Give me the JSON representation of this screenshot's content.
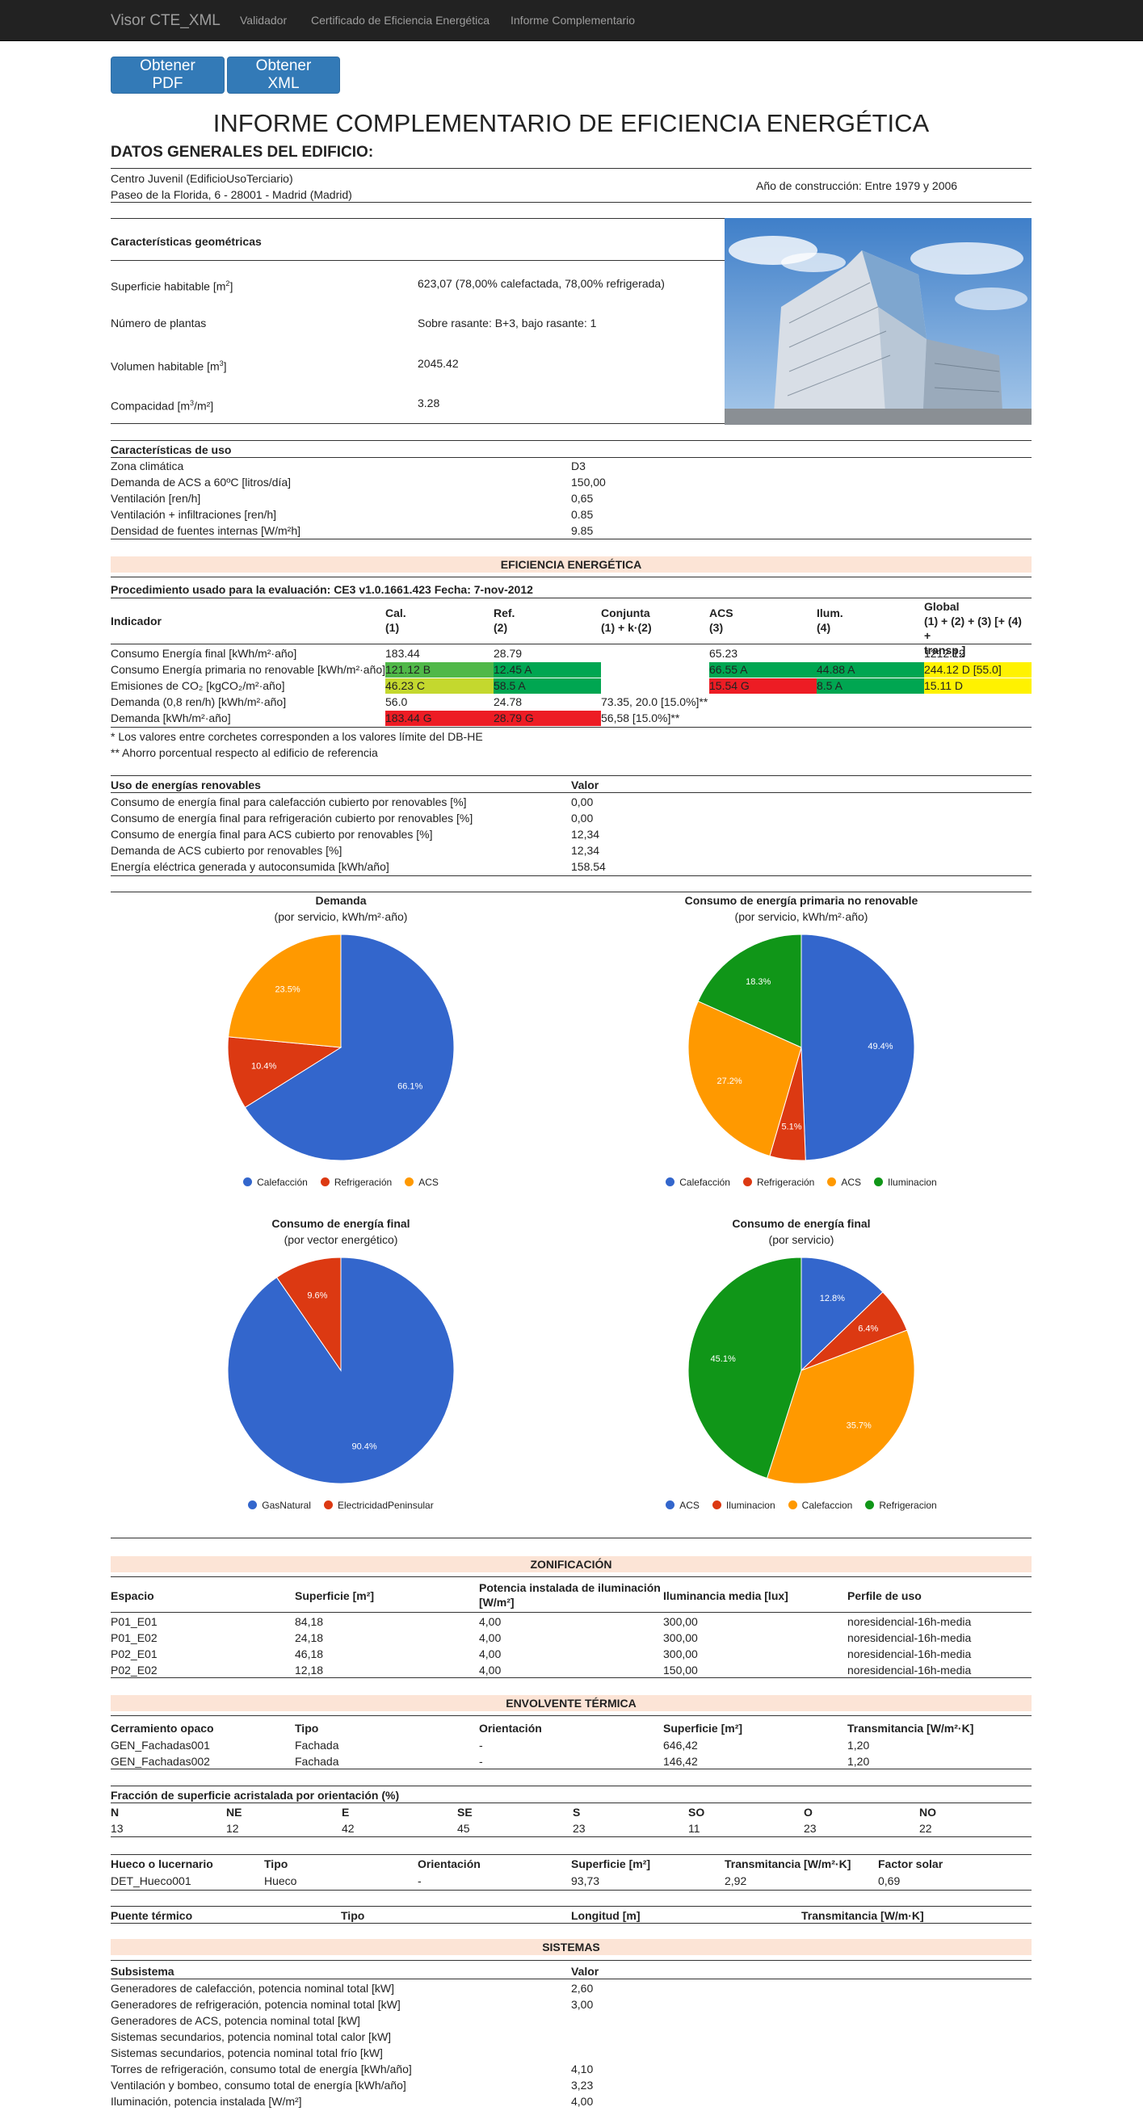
{
  "nav": {
    "brand": "Visor CTE_XML",
    "links": [
      "Validador",
      "Certificado de Eficiencia Energética",
      "Informe Complementario"
    ]
  },
  "buttons": {
    "pdf": "Obtener PDF",
    "xml": "Obtener XML"
  },
  "title": "INFORME COMPLEMENTARIO DE EFICIENCIA ENERGÉTICA",
  "datos_generales": {
    "heading": "DATOS GENERALES DEL EDIFICIO:",
    "nombre": "Centro Juvenil (EdificioUsoTerciario)",
    "direccion": "Paseo de la Florida, 6 - 28001 - Madrid (Madrid)",
    "anio": "Año de construcción: Entre 1979 y 2006"
  },
  "geometricas": {
    "heading": "Características geométricas",
    "rows": [
      {
        "label_pre": "Superficie habitable [m",
        "sup": "2",
        "label_post": "]",
        "value": "623,07 (78,00% calefactada, 78,00% refrigerada)"
      },
      {
        "label_pre": "Número de plantas",
        "sup": "",
        "label_post": "",
        "value": "Sobre rasante: B+3, bajo rasante: 1"
      },
      {
        "label_pre": "Volumen habitable [m",
        "sup": "3",
        "label_post": "]",
        "value": "2045.42"
      },
      {
        "label_pre": "Compacidad [m",
        "sup": "3",
        "label_post": "/m²]",
        "value": "3.28"
      }
    ]
  },
  "uso": {
    "heading": "Características de uso",
    "rows": [
      {
        "label": "Zona climática",
        "value": "D3"
      },
      {
        "label": "Demanda de ACS a 60ºC [litros/día]",
        "value": "150,00"
      },
      {
        "label": "Ventilación [ren/h]",
        "value": "0,65"
      },
      {
        "label": "Ventilación + infiltraciones [ren/h]",
        "value": "0.85"
      },
      {
        "label": "Densidad de fuentes internas [W/m²h]",
        "value": "9.85"
      }
    ]
  },
  "eficiencia": {
    "heading": "EFICIENCIA ENERGÉTICA",
    "procedimiento": "Procedimiento usado para la evaluación: CE3 v1.0.1661.423 Fecha: 7-nov-2012",
    "headers": [
      "Indicador",
      "Cal.\n(1)",
      "Ref.\n(2)",
      "Conjunta\n(1) + k·(2)",
      "ACS\n(3)",
      "Ilum.\n(4)",
      "Global\n(1) + (2) + (3) [+ (4) +\ntransp.]"
    ],
    "rows": [
      {
        "label": "Consumo Energía final [kWh/m²·año]",
        "cells": [
          "183.44",
          "28.79",
          "",
          "65.23",
          "",
          "1212.12"
        ],
        "colors": [
          "",
          "",
          "",
          "",
          "",
          ""
        ]
      },
      {
        "label": "Consumo Energía primaria no renovable [kWh/m²·año]",
        "cells": [
          "121.12 B",
          "12.45 A",
          "",
          "66.55 A",
          "44.88 A",
          "244.12 D [55.0]"
        ],
        "colors": [
          "#50b848",
          "#00a651",
          "",
          "#00a651",
          "#00a651",
          "#fff200"
        ]
      },
      {
        "label": "Emisiones de CO₂ [kgCO₂/m²·año]",
        "cells": [
          "46.23 C",
          "58.5 A",
          "",
          "15.54 G",
          "8.5 A",
          "15.11 D"
        ],
        "colors": [
          "#c4d82e",
          "#00a651",
          "",
          "#ed1c24",
          "#00a651",
          "#fff200"
        ]
      },
      {
        "label": "Demanda (0,8 ren/h) [kWh/m²·año]",
        "cells": [
          "56.0",
          "24.78",
          "73.35, 20.0 [15.0%]**",
          "",
          "",
          ""
        ],
        "colors": [
          "",
          "",
          "",
          "",
          "",
          ""
        ]
      },
      {
        "label": "Demanda [kWh/m²·año]",
        "cells": [
          "183.44 G",
          "28.79 G",
          "56,58 [15.0%]**",
          "",
          "",
          ""
        ],
        "colors": [
          "#ed1c24",
          "#ed1c24",
          "",
          "",
          "",
          ""
        ]
      }
    ],
    "note1": "* Los valores entre corchetes corresponden a los valores límite del DB-HE",
    "note2": "** Ahorro porcentual respecto al edificio de referencia"
  },
  "renovables": {
    "header_label": "Uso de energías renovables",
    "header_value": "Valor",
    "rows": [
      {
        "label": "Consumo de energía final para calefacción cubierto por renovables [%]",
        "value": "0,00"
      },
      {
        "label": "Consumo de energía final para refrigeración cubierto por renovables [%]",
        "value": "0,00"
      },
      {
        "label": "Consumo de energía final para ACS cubierto por renovables [%]",
        "value": "12,34"
      },
      {
        "label": "Demanda de ACS cubierto por renovables [%]",
        "value": "12,34"
      },
      {
        "label": "Energía eléctrica generada y autoconsumida [kWh/año]",
        "value": "158.54"
      }
    ]
  },
  "chart_data": [
    {
      "type": "pie",
      "title": "Demanda",
      "subtitle": "(por servicio, kWh/m²·año)",
      "categories": [
        "Calefacción",
        "Refrigeración",
        "ACS"
      ],
      "values": [
        66.1,
        10.4,
        23.5
      ],
      "labels": [
        "66.1%",
        "10.4%",
        "23.5%"
      ],
      "colors": [
        "#3366cc",
        "#dc3912",
        "#ff9900"
      ]
    },
    {
      "type": "pie",
      "title": "Consumo de energía primaria no renovable",
      "subtitle": "(por servicio, kWh/m²·año)",
      "categories": [
        "Calefacción",
        "Refrigeración",
        "ACS",
        "Iluminacion"
      ],
      "values": [
        49.4,
        5.1,
        27.2,
        18.3
      ],
      "labels": [
        "49.4%",
        "5.1%",
        "27.2%",
        "18.3%"
      ],
      "colors": [
        "#3366cc",
        "#dc3912",
        "#ff9900",
        "#109618"
      ]
    },
    {
      "type": "pie",
      "title": "Consumo de energía final",
      "subtitle": "(por vector energético)",
      "categories": [
        "GasNatural",
        "ElectricidadPeninsular"
      ],
      "values": [
        90.4,
        9.6
      ],
      "labels": [
        "90.4%",
        "9.6%"
      ],
      "colors": [
        "#3366cc",
        "#dc3912"
      ]
    },
    {
      "type": "pie",
      "title": "Consumo de energía final",
      "subtitle": "(por servicio)",
      "categories": [
        "ACS",
        "Iluminacion",
        "Calefaccion",
        "Refrigeracion"
      ],
      "values": [
        12.8,
        6.4,
        35.7,
        45.1
      ],
      "labels": [
        "12.8%",
        "6.4%",
        "35.7%",
        "45.1%"
      ],
      "colors": [
        "#3366cc",
        "#dc3912",
        "#ff9900",
        "#109618"
      ]
    }
  ],
  "zonificacion": {
    "heading": "ZONIFICACIÓN",
    "headers": [
      "Espacio",
      "Superficie [m²]",
      "Potencia instalada de iluminación\n[W/m²]",
      "Iluminancia media [lux]",
      "Perfile de uso"
    ],
    "rows": [
      [
        "P01_E01",
        "84,18",
        "4,00",
        "300,00",
        "noresidencial-16h-media"
      ],
      [
        "P01_E02",
        "24,18",
        "4,00",
        "300,00",
        "noresidencial-16h-media"
      ],
      [
        "P02_E01",
        "46,18",
        "4,00",
        "300,00",
        "noresidencial-16h-media"
      ],
      [
        "P02_E02",
        "12,18",
        "4,00",
        "150,00",
        "noresidencial-16h-media"
      ]
    ]
  },
  "envolvente": {
    "heading": "ENVOLVENTE TÉRMICA",
    "opaco_headers": [
      "Cerramiento opaco",
      "Tipo",
      "Orientación",
      "Superficie [m²]",
      "Transmitancia [W/m²·K]"
    ],
    "opaco_rows": [
      [
        "GEN_Fachadas001",
        "Fachada",
        "-",
        "646,42",
        "1,20"
      ],
      [
        "GEN_Fachadas002",
        "Fachada",
        "-",
        "146,42",
        "1,20"
      ]
    ],
    "fraccion_heading": "Fracción de superficie acristalada por orientación (%)",
    "fraccion_headers": [
      "N",
      "NE",
      "E",
      "SE",
      "S",
      "SO",
      "O",
      "NO"
    ],
    "fraccion_values": [
      "13",
      "12",
      "42",
      "45",
      "23",
      "11",
      "23",
      "22"
    ],
    "hueco_headers": [
      "Hueco o lucernario",
      "Tipo",
      "Orientación",
      "Superficie [m²]",
      "Transmitancia [W/m²·K]",
      "Factor solar"
    ],
    "hueco_rows": [
      [
        "DET_Hueco001",
        "Hueco",
        "-",
        "93,73",
        "2,92",
        "0,69"
      ]
    ],
    "puente_headers": [
      "Puente térmico",
      "Tipo",
      "Longitud [m]",
      "Transmitancia [W/m·K]"
    ]
  },
  "sistemas": {
    "heading": "SISTEMAS",
    "header_label": "Subsistema",
    "header_value": "Valor",
    "rows": [
      {
        "label": "Generadores de calefacción, potencia nominal total [kW]",
        "value": "2,60"
      },
      {
        "label": "Generadores de refrigeración, potencia nominal total [kW]",
        "value": "3,00"
      },
      {
        "label": "Generadores de ACS, potencia nominal total [kW]",
        "value": ""
      },
      {
        "label": "Sistemas secundarios, potencia nominal total calor [kW]",
        "value": ""
      },
      {
        "label": "Sistemas secundarios, potencia nominal total frío [kW]",
        "value": ""
      },
      {
        "label": "Torres de refrigeración, consumo total de energía [kWh/año]",
        "value": "4,10"
      },
      {
        "label": "Ventilación y bombeo, consumo total de energía [kWh/año]",
        "value": "3,23"
      },
      {
        "label": "Iluminación, potencia instalada [W/m²]",
        "value": "4,00"
      }
    ]
  }
}
